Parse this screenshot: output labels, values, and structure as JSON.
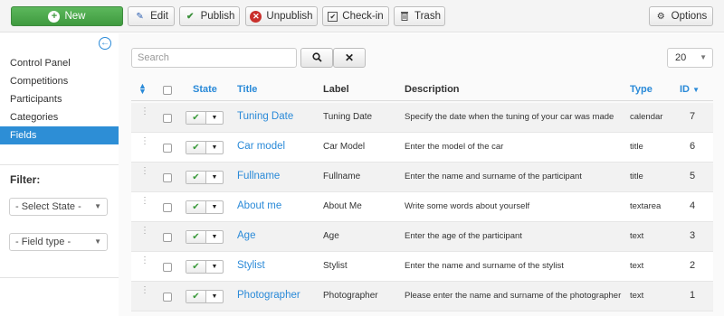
{
  "toolbar": {
    "new": "New",
    "edit": "Edit",
    "publish": "Publish",
    "unpublish": "Unpublish",
    "checkin": "Check-in",
    "trash": "Trash",
    "options": "Options"
  },
  "sidebar": {
    "items": [
      {
        "label": "Control Panel"
      },
      {
        "label": "Competitions"
      },
      {
        "label": "Participants"
      },
      {
        "label": "Categories"
      },
      {
        "label": "Fields"
      }
    ],
    "active_index": 4,
    "filter_title": "Filter:",
    "filters": [
      "- Select State -",
      "- Field type -"
    ]
  },
  "search": {
    "placeholder": "Search"
  },
  "list_limit": "20",
  "table": {
    "headers": {
      "state": "State",
      "title": "Title",
      "label": "Label",
      "description": "Description",
      "type": "Type",
      "id": "ID"
    },
    "rows": [
      {
        "title": "Tuning Date",
        "label": "Tuning Date",
        "description": "Specify the date when the tuning of your car was made",
        "type": "calendar",
        "id": "7"
      },
      {
        "title": "Car model",
        "label": "Car Model",
        "description": "Enter the model of the car",
        "type": "title",
        "id": "6"
      },
      {
        "title": "Fullname",
        "label": "Fullname",
        "description": "Enter the name and surname of the participant",
        "type": "title",
        "id": "5"
      },
      {
        "title": "About me",
        "label": "About Me",
        "description": "Write some words about yourself",
        "type": "textarea",
        "id": "4"
      },
      {
        "title": "Age",
        "label": "Age",
        "description": "Enter the age of the participant",
        "type": "text",
        "id": "3"
      },
      {
        "title": "Stylist",
        "label": "Stylist",
        "description": "Enter the name and surname of the stylist",
        "type": "text",
        "id": "2"
      },
      {
        "title": "Photographer",
        "label": "Photographer",
        "description": "Please enter the name and surname of the photographer",
        "type": "text",
        "id": "1"
      }
    ]
  },
  "colors": {
    "accent": "#2a8ad8",
    "new_button": "#4cae4c",
    "active_sidebar": "#2d8ed6",
    "unpublish_icon": "#c9302c"
  }
}
